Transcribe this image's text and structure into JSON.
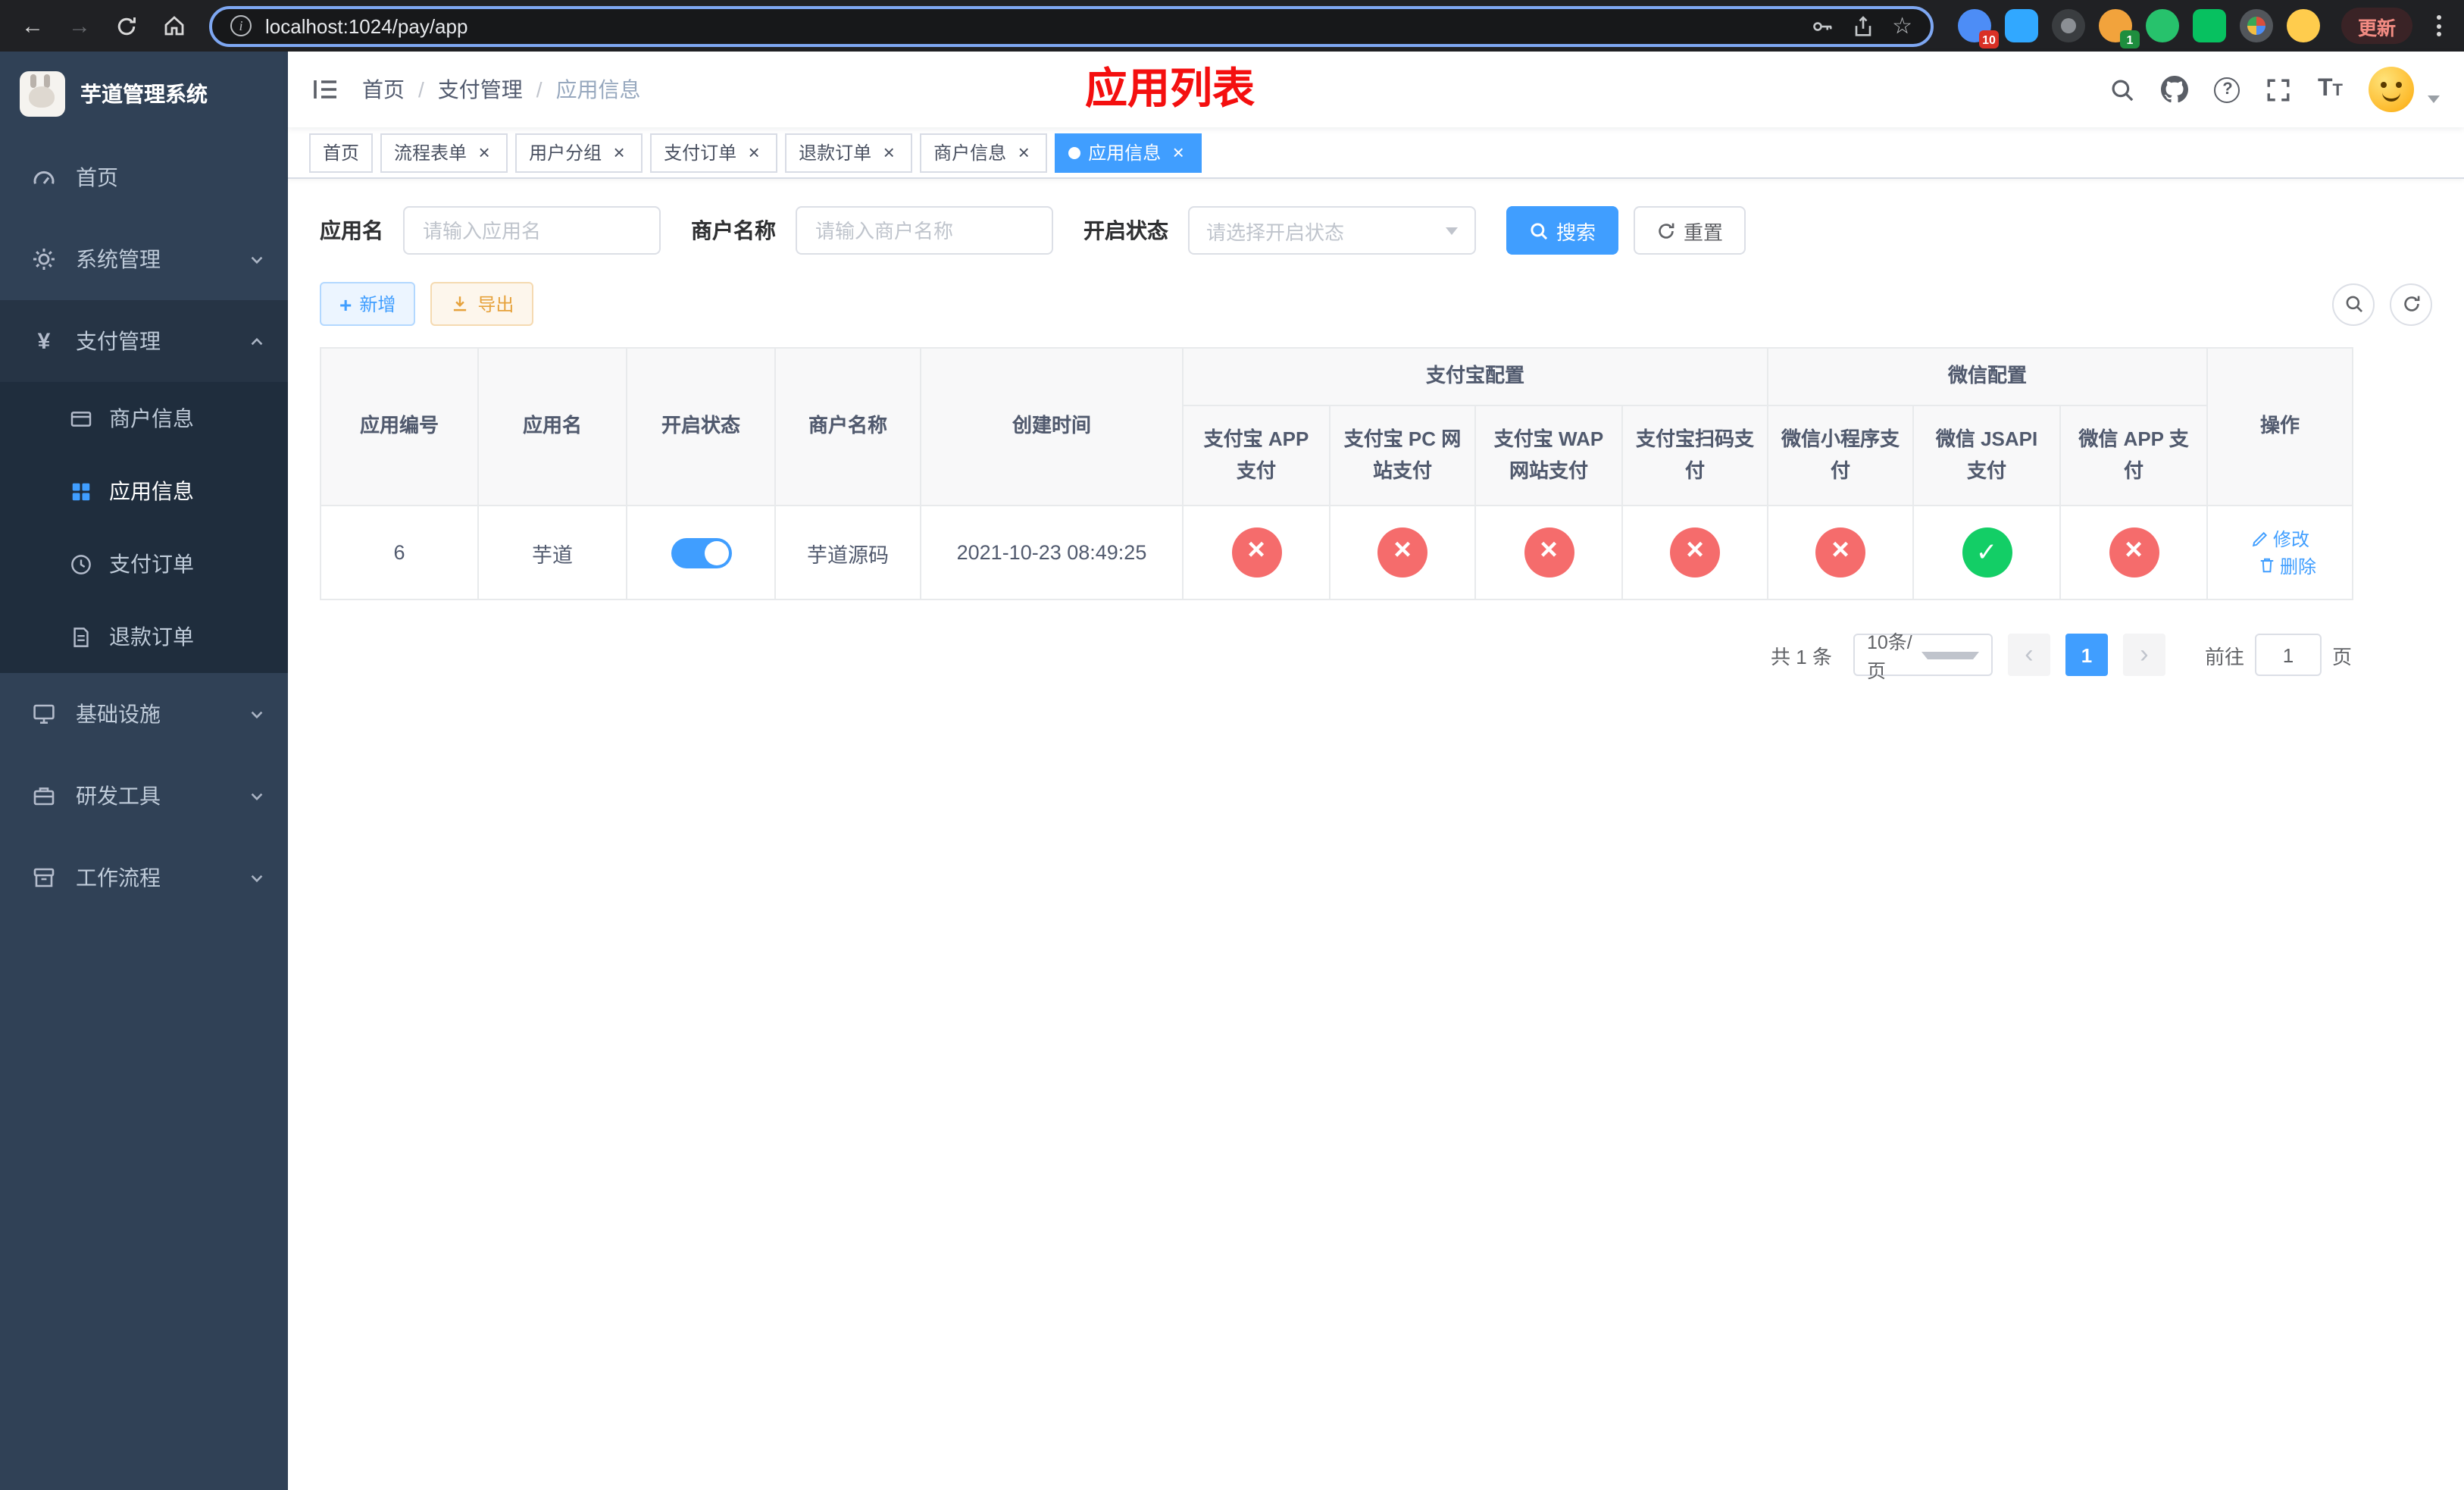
{
  "colors": {
    "accent": "#409eff",
    "title-red": "#f40f0f",
    "success": "#13ce66",
    "danger": "#f56c6c",
    "warning": "#e6a23c"
  },
  "browser": {
    "url": "localhost:1024/pay/app",
    "update_label": "更新",
    "ext_badge_1": "10",
    "ext_badge_2": "1"
  },
  "sidebar": {
    "logo_title": "芋道管理系统",
    "items": [
      {
        "label": "首页"
      },
      {
        "label": "系统管理"
      },
      {
        "label": "支付管理"
      },
      {
        "label": "商户信息"
      },
      {
        "label": "应用信息"
      },
      {
        "label": "支付订单"
      },
      {
        "label": "退款订单"
      },
      {
        "label": "基础设施"
      },
      {
        "label": "研发工具"
      },
      {
        "label": "工作流程"
      }
    ]
  },
  "header": {
    "breadcrumb": {
      "home": "首页",
      "section": "支付管理",
      "page": "应用信息"
    },
    "breadcrumb_separator": "/",
    "page_title": "应用列表"
  },
  "tabs": [
    {
      "label": "首页"
    },
    {
      "label": "流程表单"
    },
    {
      "label": "用户分组"
    },
    {
      "label": "支付订单"
    },
    {
      "label": "退款订单"
    },
    {
      "label": "商户信息"
    },
    {
      "label": "应用信息"
    }
  ],
  "filters": {
    "app_name_label": "应用名",
    "app_name_placeholder": "请输入应用名",
    "merchant_label": "商户名称",
    "merchant_placeholder": "请输入商户名称",
    "status_label": "开启状态",
    "status_placeholder": "请选择开启状态",
    "search_label": "搜索",
    "reset_label": "重置"
  },
  "toolbar": {
    "add_label": "新增",
    "export_label": "导出"
  },
  "table": {
    "columns": {
      "app_id": "应用编号",
      "app_name": "应用名",
      "status": "开启状态",
      "merchant": "商户名称",
      "create_time": "创建时间",
      "ops": "操作"
    },
    "groups": {
      "alipay": {
        "label": "支付宝配置",
        "children": [
          "支付宝 APP 支付",
          "支付宝 PC 网站支付",
          "支付宝 WAP 网站支付",
          "支付宝扫码支付"
        ]
      },
      "wechat": {
        "label": "微信配置",
        "children": [
          "微信小程序支付",
          "微信 JSAPI 支付",
          "微信 APP 支付"
        ]
      }
    },
    "rows": [
      {
        "app_id": "6",
        "app_name": "芋道",
        "enabled": true,
        "merchant": "芋道源码",
        "create_time": "2021-10-23 08:49:25",
        "configs": [
          false,
          false,
          false,
          false,
          false,
          true,
          false
        ],
        "edit_label": "修改",
        "delete_label": "删除"
      }
    ]
  },
  "pagination": {
    "total": "共 1 条",
    "page_size": "10条/页",
    "page": "1",
    "goto_prefix": "前往",
    "goto_value": "1",
    "goto_suffix": "页"
  }
}
